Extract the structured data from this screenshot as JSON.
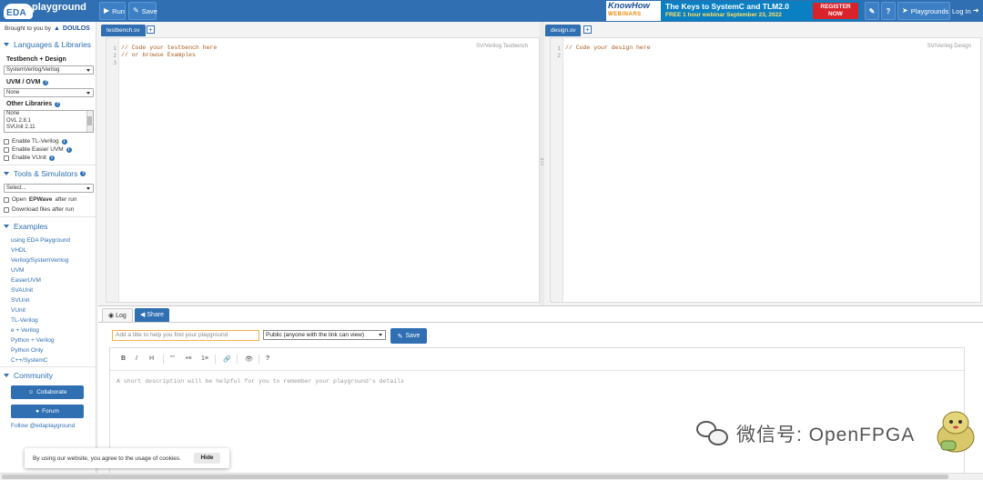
{
  "topbar": {
    "logo_eda": "EDA",
    "logo_playground": "playground",
    "run_label": "Run",
    "save_label": "Save",
    "playgrounds_label": "Playgrounds",
    "login_label": "Log In",
    "help_label": "?"
  },
  "ad": {
    "brand": "KnowHow",
    "sub": "WEBINARS",
    "line1": "The Keys to SystemC and TLM2.0",
    "line2": "FREE 1 hour webinar September 23, 2022",
    "cta_line1": "REGISTER",
    "cta_line2": "NOW"
  },
  "sidebar": {
    "brought_by": "Brought to you by",
    "brought_by_brand": "DOULOS",
    "languages_header": "Languages & Libraries",
    "testbench_design_label": "Testbench + Design",
    "language_select": "SystemVerilog/Verilog",
    "uvm_label": "UVM / OVM",
    "uvm_select": "None",
    "other_libraries_label": "Other Libraries",
    "other_libraries": [
      "None",
      "OVL 2.8.1",
      "SVUnit 2.11"
    ],
    "checkboxes": [
      "Enable TL-Verilog",
      "Enable Easier UVM",
      "Enable VUnit"
    ],
    "tools_header": "Tools & Simulators",
    "tools_select": "Select...",
    "open_epwave_prefix": "Open",
    "open_epwave_bold": "EPWave",
    "open_epwave_suffix": "after run",
    "download_files": "Download files after run",
    "examples_header": "Examples",
    "examples": [
      "using EDA Playground",
      "VHDL",
      "Verilog/SystemVerilog",
      "UVM",
      "EasierUVM",
      "SVAUnit",
      "SVUnit",
      "VUnit",
      "TL-Verilog",
      "e + Verilog",
      "Python + Verilog",
      "Python Only",
      "C++/SystemC"
    ],
    "community_header": "Community",
    "collaborate_label": "Collaborate",
    "forum_label": "Forum",
    "follow_label": "Follow @edaplayground"
  },
  "testbench": {
    "tab": "testbench.sv",
    "lang": "SV/Verilog Testbench",
    "lines": [
      "// Code your testbench here",
      "// or browse Examples",
      ""
    ]
  },
  "design": {
    "tab": "design.sv",
    "lang": "SV/Verilog Design",
    "lines": [
      "// Code your design here",
      ""
    ]
  },
  "bottom": {
    "log_tab": "Log",
    "share_tab": "Share",
    "title_placeholder": "Add a title to help you find your playground",
    "visibility": "Public (anyone with the link can view)",
    "save_label": "Save",
    "toolbar": [
      "B",
      "I",
      "H",
      "“”",
      "•≡",
      "1≡",
      "🔗",
      "👁",
      "?"
    ],
    "description_placeholder": "A short description will be helpful for you to remember your playground's details"
  },
  "cookie": {
    "message": "By using our website, you agree to the usage of cookies.",
    "hide_label": "Hide"
  },
  "watermark": {
    "text": "微信号: OpenFPGA"
  }
}
